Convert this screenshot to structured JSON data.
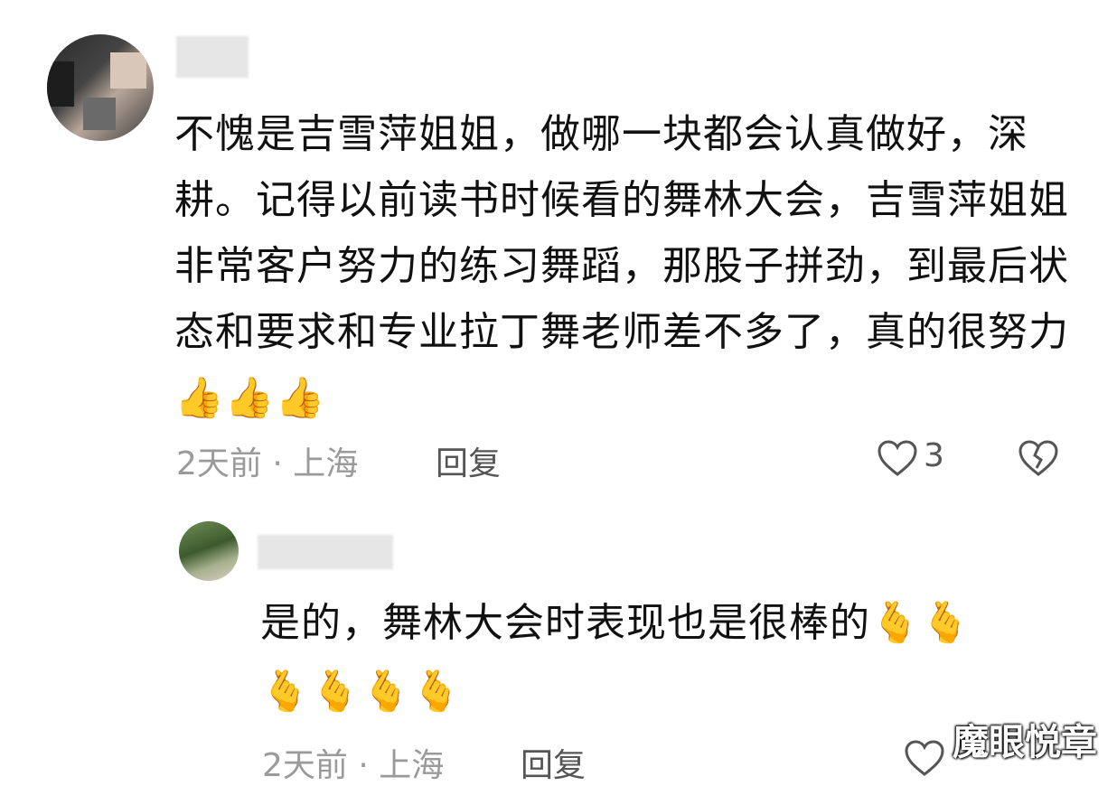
{
  "comment": {
    "text": "不愧是吉雪萍姐姐，做哪一块都会认真做好，深耕。记得以前读书时候看的舞林大会，吉雪萍姐姐非常客户努力的练习舞蹈，那股子拼劲，到最后状态和要求和专业拉丁舞老师差不多了，真的很努力",
    "emoji": "👍👍👍",
    "time_location": "2天前 · 上海",
    "reply_label": "回复",
    "like_count": "3"
  },
  "reply": {
    "text": "是的，舞林大会时表现也是很棒的",
    "emoji_inline": "🫰🫰",
    "emoji_line": "🫰🫰🫰🫰",
    "time_location": "2天前 · 上海",
    "reply_label": "回复"
  },
  "watermark": "魔眼悦章",
  "colors": {
    "meta_gray": "#9a9a9a",
    "icon_gray": "#555555",
    "text": "#111111"
  }
}
